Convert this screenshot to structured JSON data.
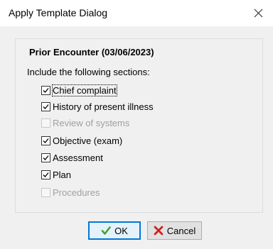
{
  "window": {
    "title": "Apply Template Dialog"
  },
  "encounter": {
    "title": "Prior Encounter (03/06/2023)",
    "include_label": "Include the following sections:"
  },
  "sections": [
    {
      "label": "Chief complaint",
      "checked": true,
      "enabled": true
    },
    {
      "label": "History of present illness",
      "checked": true,
      "enabled": true
    },
    {
      "label": "Review of systems",
      "checked": false,
      "enabled": false
    },
    {
      "label": "Objective (exam)",
      "checked": true,
      "enabled": true
    },
    {
      "label": "Assessment",
      "checked": true,
      "enabled": true
    },
    {
      "label": "Plan",
      "checked": true,
      "enabled": true
    },
    {
      "label": "Procedures",
      "checked": false,
      "enabled": false
    }
  ],
  "buttons": {
    "ok_label": "OK",
    "cancel_label": "Cancel"
  },
  "icons": {
    "ok": "green-checkmark-icon",
    "cancel": "red-x-icon",
    "close": "close-icon"
  },
  "colors": {
    "ok_border": "#0078d7",
    "check_green": "#3fa535",
    "cancel_red": "#d32020"
  }
}
